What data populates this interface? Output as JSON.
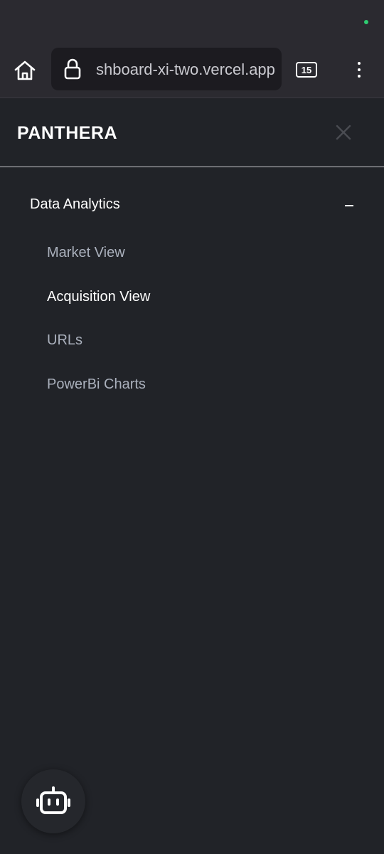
{
  "browser": {
    "url": "shboard-xi-two.vercel.app",
    "tab_count": "15"
  },
  "drawer": {
    "brand": "PANTHERA",
    "section": {
      "title": "Data Analytics",
      "expanded": true,
      "items": [
        {
          "label": "Market View",
          "active": false
        },
        {
          "label": "Acquisition View",
          "active": true
        },
        {
          "label": "URLs",
          "active": false
        },
        {
          "label": "PowerBi Charts",
          "active": false
        }
      ]
    }
  },
  "colors": {
    "background": "#212328",
    "browser_chrome": "#2b2a30",
    "active_text": "#ffffff",
    "inactive_text": "#aab0bc",
    "status_dot": "#2ecc71"
  },
  "icons": {
    "home": "home-icon",
    "lock": "lock-icon",
    "tabs": "tabs-icon",
    "menu": "more-vertical-icon",
    "close": "close-icon",
    "collapse": "minus-icon",
    "bot": "bot-icon"
  }
}
